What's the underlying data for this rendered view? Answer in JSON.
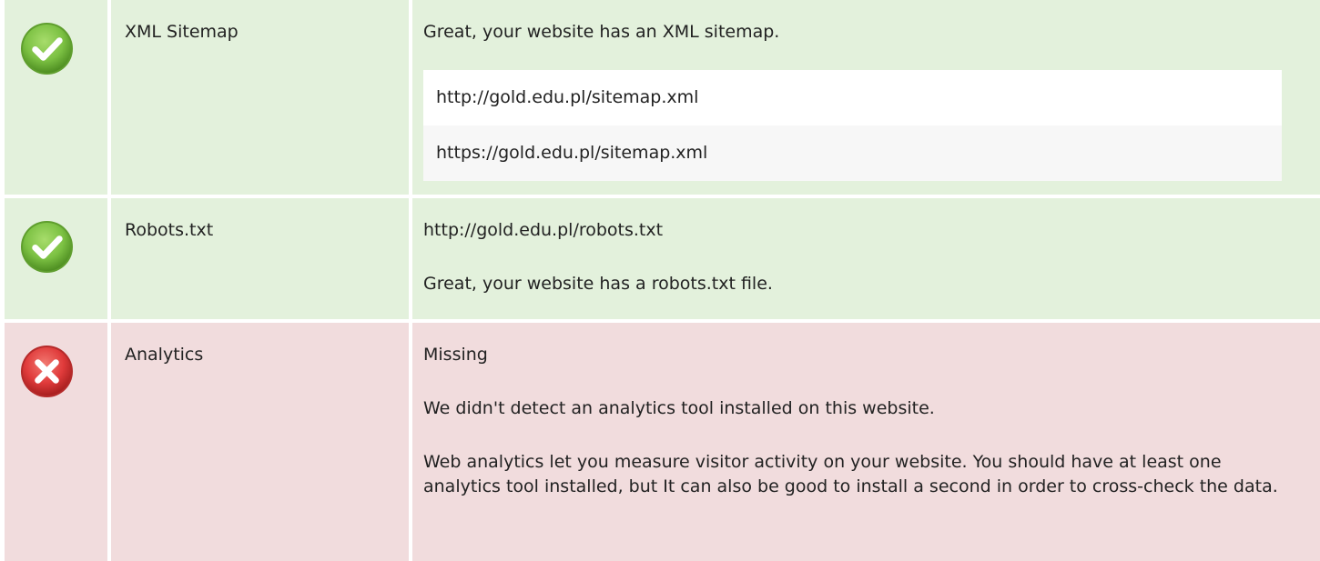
{
  "colors": {
    "pass_bg": "#e3f1dc",
    "fail_bg": "#f1dcdd",
    "pass_icon": "#7cc143",
    "fail_icon": "#e03b3b"
  },
  "rows": [
    {
      "status": "pass",
      "icon": "check-circle-icon",
      "label": "XML Sitemap",
      "message": "Great, your website has an XML sitemap.",
      "urls": [
        "http://gold.edu.pl/sitemap.xml",
        "https://gold.edu.pl/sitemap.xml"
      ]
    },
    {
      "status": "pass",
      "icon": "check-circle-icon",
      "label": "Robots.txt",
      "url": "http://gold.edu.pl/robots.txt",
      "message": "Great, your website has a robots.txt file."
    },
    {
      "status": "fail",
      "icon": "error-circle-icon",
      "label": "Analytics",
      "value": "Missing",
      "message": "We didn't detect an analytics tool installed on this website.",
      "description": "Web analytics let you measure visitor activity on your website. You should have at least one analytics tool installed, but It can also be good to install a second in order to cross-check the data."
    }
  ]
}
